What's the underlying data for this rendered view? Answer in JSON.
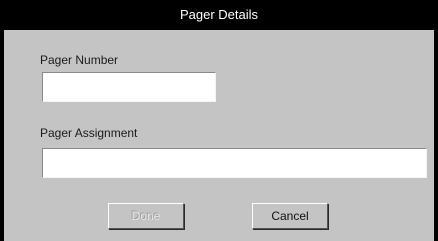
{
  "dialog": {
    "title": "Pager Details"
  },
  "form": {
    "pager_number_label": "Pager Number",
    "pager_number_value": "",
    "pager_assignment_label": "Pager Assignment",
    "pager_assignment_value": ""
  },
  "buttons": {
    "done_label": "Done",
    "done_enabled": false,
    "cancel_label": "Cancel"
  }
}
